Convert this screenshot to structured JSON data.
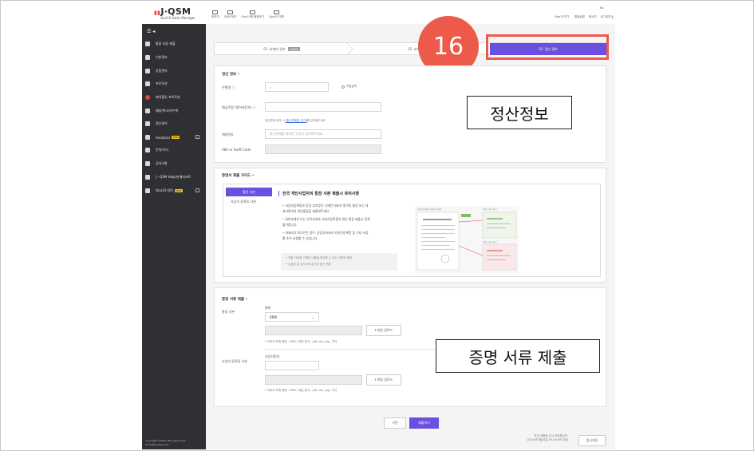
{
  "header": {
    "logo_text": "J·QSM",
    "logo_sub": "Qoo10 Sales Manager",
    "nav": [
      "한국어",
      "QSM 정보",
      "Qoo10에 출점하기",
      "Qoo10 대학"
    ],
    "qoo10_link": "Qoo10가기",
    "links": [
      "알림설정",
      "메시지",
      "로그아웃"
    ],
    "user": "NL",
    "close": "X"
  },
  "sidebar": {
    "toggle": "☰ ◂",
    "items": [
      {
        "label": "통합 서류 제출",
        "icon": "document-icon"
      },
      {
        "label": "기본정보",
        "icon": "gear-icon"
      },
      {
        "label": "상품관리",
        "icon": "box-icon"
      },
      {
        "label": "프로모션",
        "icon": "bell-icon"
      },
      {
        "label": "메가할인 프로모션",
        "icon": "p-badge-icon"
      },
      {
        "label": "배송/취소/미수취",
        "icon": "truck-icon"
      },
      {
        "label": "정산관리",
        "icon": "money-icon"
      },
      {
        "label": "Analytics",
        "icon": "chart-icon",
        "badge": "NEW"
      },
      {
        "label": "문의/기타",
        "icon": "user-icon"
      },
      {
        "label": "공지사항",
        "icon": "speech-icon"
      },
      {
        "label": "J・QSM Help/판매서포트",
        "icon": "help-icon"
      },
      {
        "label": "Qoo10 대학",
        "icon": "school-icon",
        "badge": "NEW"
      }
    ],
    "footer": [
      "Copyright ©2024 eBay Japan G.K.",
      "All Rights Reserved."
    ]
  },
  "steps": [
    {
      "label": "01. 판매자 정보",
      "badge": "작성완료"
    },
    {
      "label": "02. 판매 정보"
    },
    {
      "label": "03. 정산 정보"
    }
  ],
  "callouts": {
    "step_number": "16",
    "settlement_label": "정산정보",
    "documents_label": "증명 서류 제출"
  },
  "settlement": {
    "title": "정산 정보",
    "bank_label": "은행명",
    "direct_input": "직접입력",
    "holder_label": "예금주명 (영어대문자)",
    "holder_hint_pre": "통신판매 입력 시 ",
    "holder_hint_link": "[통신판매업 표기]",
    "holder_hint_post": "를 참고해주세요",
    "account_label": "계좌번호",
    "account_placeholder": "통신판매를 제외한 숫자만 입력해주세요",
    "swift_label": "ABA or Swift Code"
  },
  "guide": {
    "title": "증명서 제출 가이드",
    "tab_active": "통장 사본",
    "tab_other": "사업자 등록증 사본",
    "heading": "한국 개인사업자의 통장 사본 제출시 유의사항",
    "lines": [
      "• 사업자등록증과 동일 상호명이 기재된 대표자 명의의 통장 또는 대",
      "  표자명의의 개인통장을 제출해주세요.",
      "• 일반과세자 또는 간이과세자 사업자등록증의 법인 통장 제출시 등록",
      "  불가합니다.",
      "• 대표자가 외국인인 경우, 당당부서에서 외국인등록증 및 기타 서류",
      "  를 추가 요청할 수 있습니다."
    ],
    "notes": [
      "• 제출 자료에 기재된 내용을 확인할 수 있는 선명한 화질",
      "• 유효성 및 유사서의 분석이 없는 원본"
    ],
    "img_top_left": "[증빙자료제출 사업자등록증]",
    "img_top_right": "[통장 사본 예시]",
    "img_bottom_right": "[통장 사본 예시]"
  },
  "documents": {
    "title": "증명 서류 제출",
    "bank_copy_label": "통장 사본",
    "currency_label": "통화",
    "currency_value": "KRW",
    "upload_btn": "파일 업로드",
    "upload_hint": "* 이미지 최대 용량 : 5MB / 파일 형식 : pdf, doc, jpg, 기타",
    "biz_label": "사업자 등록증 사본",
    "biz_number_label": "사업자번호"
  },
  "footer": {
    "prev": "이전",
    "submit": "제출하기",
    "note_line1": "작성 내용을 임시 저장합니다.",
    "note_line2": "(2024년7월16일 09:16:58 저장)",
    "temp_save": "임시저장"
  },
  "colors": {
    "accent": "#6a4fe0",
    "callout": "#ee5a49",
    "sidebar": "#2f3033"
  }
}
